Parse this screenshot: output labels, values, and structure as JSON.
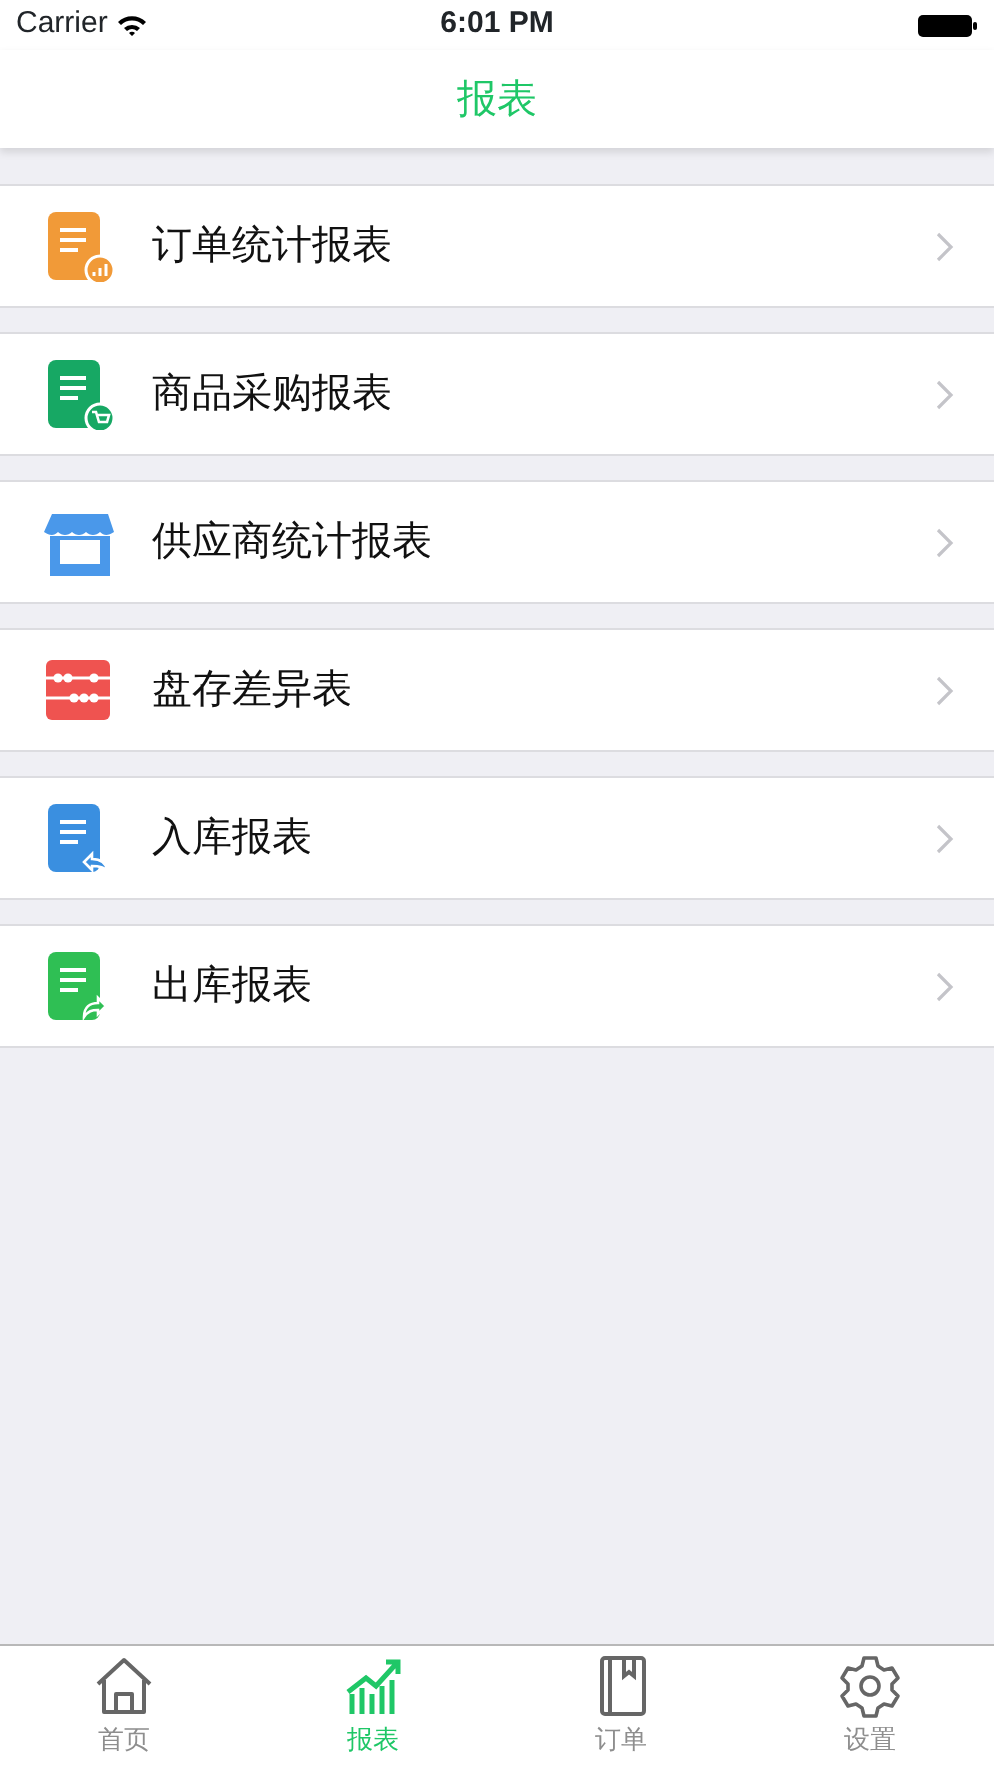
{
  "status_bar": {
    "carrier": "Carrier",
    "time": "6:01 PM"
  },
  "nav_bar": {
    "title": "报表"
  },
  "reports": [
    {
      "label": "订单统计报表",
      "kind": "doc-chart",
      "color": "#f19a38"
    },
    {
      "label": "商品采购报表",
      "kind": "doc-cart",
      "color": "#17a864"
    },
    {
      "label": "供应商统计报表",
      "kind": "store",
      "color": "#4a98ea"
    },
    {
      "label": "盘存差异表",
      "kind": "abacus",
      "color": "#ef5350"
    },
    {
      "label": "入库报表",
      "kind": "doc-in",
      "color": "#3a8fe0"
    },
    {
      "label": "出库报表",
      "kind": "doc-out",
      "color": "#2fbf54"
    }
  ],
  "tab_bar": [
    {
      "label": "首页",
      "kind": "home",
      "selected": false
    },
    {
      "label": "报表",
      "kind": "chart",
      "selected": true
    },
    {
      "label": "订单",
      "kind": "book",
      "selected": false
    },
    {
      "label": "设置",
      "kind": "gear",
      "selected": false
    }
  ]
}
